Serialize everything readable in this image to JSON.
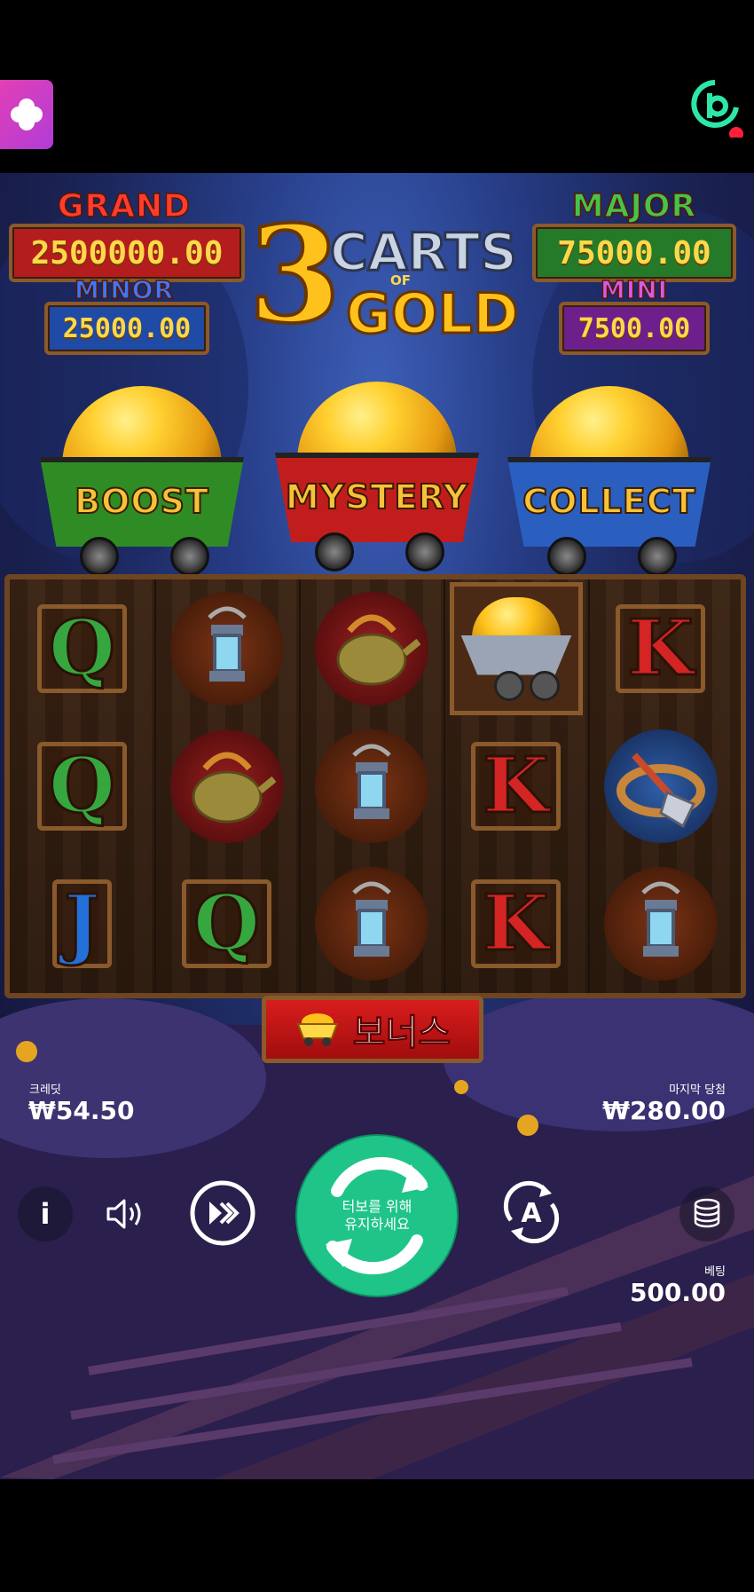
{
  "jackpots": {
    "grand": {
      "label": "GRAND",
      "value": "2500000.00",
      "color": "#d42424"
    },
    "major": {
      "label": "MAJOR",
      "value": "75000.00",
      "color": "#2e9a36"
    },
    "minor": {
      "label": "MINOR",
      "value": "25000.00",
      "color": "#2d5fc6"
    },
    "mini": {
      "label": "MINI",
      "value": "7500.00",
      "color": "#8a2aa8"
    }
  },
  "logo": {
    "number": "3",
    "line1": "CARTS",
    "line2": "OF",
    "line3": "GOLD"
  },
  "carts": [
    {
      "label": "BOOST",
      "color": "#3a9a2c"
    },
    {
      "label": "MYSTERY",
      "color": "#c81f1f"
    },
    {
      "label": "COLLECT",
      "color": "#2a64c8"
    }
  ],
  "reels": [
    [
      "Q",
      "Q",
      "J"
    ],
    [
      "lantern",
      "kettle",
      "Q"
    ],
    [
      "kettle",
      "lantern",
      "lantern"
    ],
    [
      "gold-cart",
      "K",
      "K"
    ],
    [
      "K",
      "shovel",
      "lantern"
    ]
  ],
  "bonus_button": {
    "label": "보너스"
  },
  "credit": {
    "label": "크레딧",
    "value": "₩54.50"
  },
  "last_win": {
    "label": "마지막 당첨",
    "value": "₩280.00"
  },
  "spin": {
    "line1": "터보를 위해",
    "line2": "유지하세요"
  },
  "bet": {
    "label": "베팅",
    "value": "500.00"
  },
  "colors": {
    "spin": "#1fc489",
    "brand": "#2ee6a8",
    "brand_dot": "#ff1f3a"
  }
}
